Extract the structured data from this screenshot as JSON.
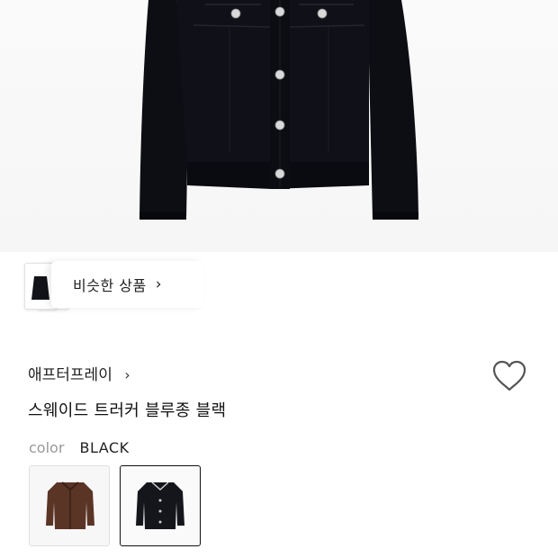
{
  "similar": {
    "label": "비슷한 상품",
    "chevron": "chevron-right-icon"
  },
  "product": {
    "brand": "애프터프레이",
    "brand_chevron": "chevron-right-icon",
    "title": "스웨이드 트러커 블루종 블랙",
    "wishlist_icon": "heart-outline-icon"
  },
  "color_option": {
    "label": "color",
    "value": "BLACK",
    "swatches": [
      {
        "name": "brown",
        "color": "#5a3526",
        "selected": false
      },
      {
        "name": "black",
        "color": "#14161c",
        "selected": true
      }
    ]
  }
}
